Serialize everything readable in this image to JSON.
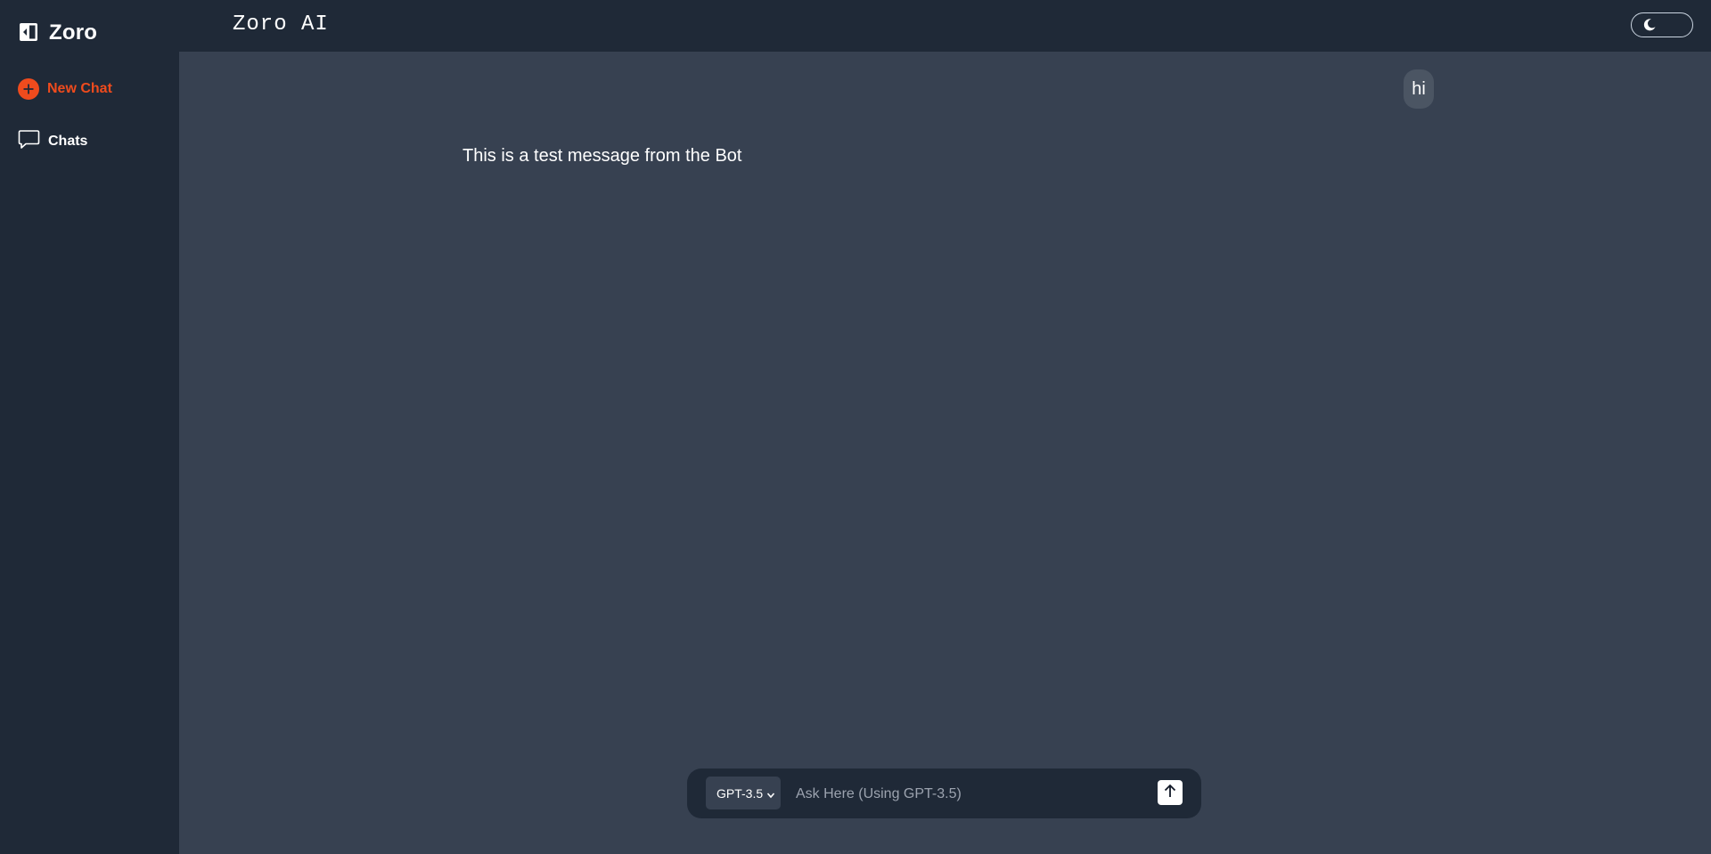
{
  "sidebar": {
    "brand": "Zoro",
    "collapse_icon": "sidebar-collapse-icon",
    "items": [
      {
        "label": "New Chat",
        "icon": "plus-circle-icon",
        "color": "#ef4b1d"
      },
      {
        "label": "Chats",
        "icon": "chat-bubble-icon"
      }
    ]
  },
  "header": {
    "title": "Zoro AI",
    "theme_toggle_icon": "moon-icon"
  },
  "conversation": {
    "messages": [
      {
        "role": "user",
        "text": "hi"
      },
      {
        "role": "bot",
        "text": "This is a test message from the Bot"
      }
    ]
  },
  "composer": {
    "model_selected": "GPT-3.5",
    "placeholder": "Ask Here (Using GPT-3.5)",
    "send_icon": "arrow-up-icon"
  },
  "colors": {
    "background": "#374151",
    "panel": "#1f2937",
    "accent": "#ef4b1d"
  }
}
